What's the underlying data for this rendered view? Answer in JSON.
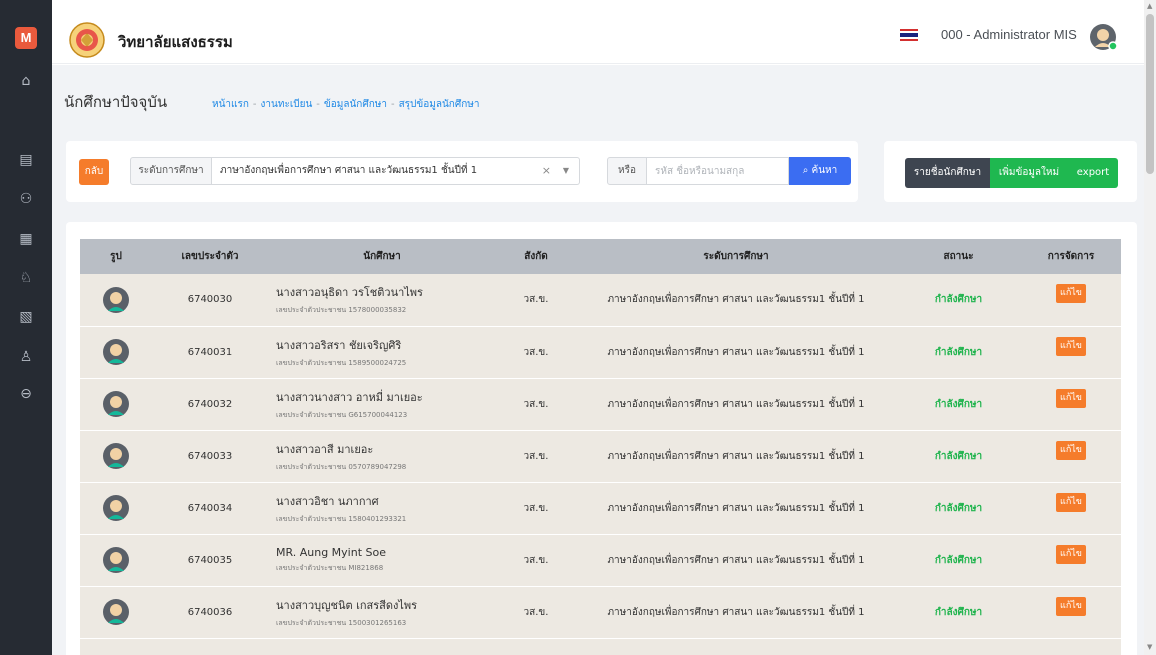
{
  "sidebar": {
    "logo": "M",
    "items": [
      {
        "icon": "home-icon",
        "glyph": "⌂"
      },
      {
        "icon": "book-icon",
        "glyph": "▤"
      },
      {
        "icon": "users-icon",
        "glyph": "⚇"
      },
      {
        "icon": "calendar-icon",
        "glyph": "▦"
      },
      {
        "icon": "teacher-icon",
        "glyph": "♘"
      },
      {
        "icon": "document-icon",
        "glyph": "▧"
      },
      {
        "icon": "user-settings-icon",
        "glyph": "♙"
      },
      {
        "icon": "logout-icon",
        "glyph": "⊖"
      }
    ]
  },
  "header": {
    "site_title": "วิทยาลัยแสงธรรม",
    "user_name": "000 - Administrator MIS"
  },
  "page": {
    "title": "นักศึกษาปัจจุบัน",
    "breadcrumb": [
      "หน้าแรก",
      "งานทะเบียน",
      "ข้อมูลนักศึกษา",
      "สรุปข้อมูลนักศึกษา"
    ]
  },
  "filter": {
    "back_label": "กลับ",
    "level_label": "ระดับการศึกษา",
    "level_value": "ภาษาอังกฤษเพื่อการศึกษา ศาสนา และวัฒนธรรม1 ชั้นปีที่ 1",
    "clear": "×",
    "arrow": "▼",
    "or_label": "หรือ",
    "search_placeholder": "รหัส ชื่อหรือนามสกุล",
    "search_label": "ค้นหา",
    "search_icon": "⌕"
  },
  "actions": {
    "list_label": "รายชื่อนักศึกษา",
    "add_label": "เพิ่มข้อมูลใหม่",
    "export_label": "export"
  },
  "table": {
    "headers": {
      "photo": "รูป",
      "student_id": "เลขประจำตัว",
      "student": "นักศึกษา",
      "affiliation": "สังกัด",
      "level": "ระดับการศึกษา",
      "status": "สถานะ",
      "manage": "การจัดการ"
    },
    "rows": [
      {
        "id": "6740030",
        "name": "นางสาวอนุธิดา วรโชติวนาไพร",
        "citizen": "เลขประจำตัวประชาชน 1578000035832",
        "affiliation": "วส.ข.",
        "level": "ภาษาอังกฤษเพื่อการศึกษา ศาสนา และวัฒนธรรม1 ชั้นปีที่ 1",
        "status": "กำลังศึกษา",
        "action": "แก้ไข"
      },
      {
        "id": "6740031",
        "name": "นางสาวอริสรา ชัยเจริญศิริ",
        "citizen": "เลขประจำตัวประชาชน 1589500024725",
        "affiliation": "วส.ข.",
        "level": "ภาษาอังกฤษเพื่อการศึกษา ศาสนา และวัฒนธรรม1 ชั้นปีที่ 1",
        "status": "กำลังศึกษา",
        "action": "แก้ไข"
      },
      {
        "id": "6740032",
        "name": "นางสาวนางสาว อาหมี่ มาเยอะ",
        "citizen": "เลขประจำตัวประชาชน G615700044123",
        "affiliation": "วส.ข.",
        "level": "ภาษาอังกฤษเพื่อการศึกษา ศาสนา และวัฒนธรรม1 ชั้นปีที่ 1",
        "status": "กำลังศึกษา",
        "action": "แก้ไข"
      },
      {
        "id": "6740033",
        "name": "นางสาวอาสี มาเยอะ",
        "citizen": "เลขประจำตัวประชาชน 0570789047298",
        "affiliation": "วส.ข.",
        "level": "ภาษาอังกฤษเพื่อการศึกษา ศาสนา และวัฒนธรรม1 ชั้นปีที่ 1",
        "status": "กำลังศึกษา",
        "action": "แก้ไข"
      },
      {
        "id": "6740034",
        "name": "นางสาวอิชา นภากาศ",
        "citizen": "เลขประจำตัวประชาชน 1580401293321",
        "affiliation": "วส.ข.",
        "level": "ภาษาอังกฤษเพื่อการศึกษา ศาสนา และวัฒนธรรม1 ชั้นปีที่ 1",
        "status": "กำลังศึกษา",
        "action": "แก้ไข"
      },
      {
        "id": "6740035",
        "name": "MR. Aung Myint Soe",
        "citizen": "เลขประจำตัวประชาชน MI821868",
        "affiliation": "วส.ข.",
        "level": "ภาษาอังกฤษเพื่อการศึกษา ศาสนา และวัฒนธรรม1 ชั้นปีที่ 1",
        "status": "กำลังศึกษา",
        "action": "แก้ไข"
      },
      {
        "id": "6740036",
        "name": "นางสาวบุญชนิต เกสรสีดงไพร",
        "citizen": "เลขประจำตัวประชาชน 1500301265163",
        "affiliation": "วส.ข.",
        "level": "ภาษาอังกฤษเพื่อการศึกษา ศาสนา และวัฒนธรรม1 ชั้นปีที่ 1",
        "status": "กำลังศึกษา",
        "action": "แก้ไข"
      }
    ]
  },
  "colors": {
    "sidebar_bg": "#262b33",
    "accent_orange": "#f57c2b",
    "primary_blue": "#3b6df2",
    "success_green": "#1fb850",
    "header_gray": "#b9bec5",
    "row_bg": "#ede9e2"
  }
}
